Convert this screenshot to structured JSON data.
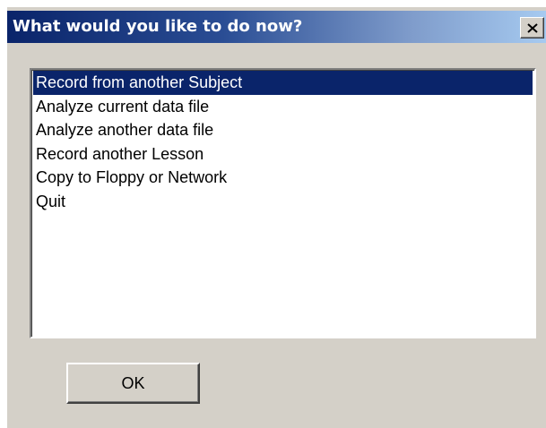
{
  "window": {
    "title": "What would you like to do now?"
  },
  "icons": {
    "close": "close-icon"
  },
  "colors": {
    "titlebar_start": "#0a246a",
    "titlebar_end": "#a6caf0",
    "selection": "#0a246a",
    "dialog_background": "#d4d0c8"
  },
  "options": {
    "selected_index": 0,
    "items": [
      {
        "label": "Record from another Subject"
      },
      {
        "label": "Analyze current data file"
      },
      {
        "label": "Analyze another data file"
      },
      {
        "label": "Record another Lesson"
      },
      {
        "label": "Copy to Floppy or Network"
      },
      {
        "label": "Quit"
      }
    ]
  },
  "buttons": {
    "ok_label": "OK"
  }
}
